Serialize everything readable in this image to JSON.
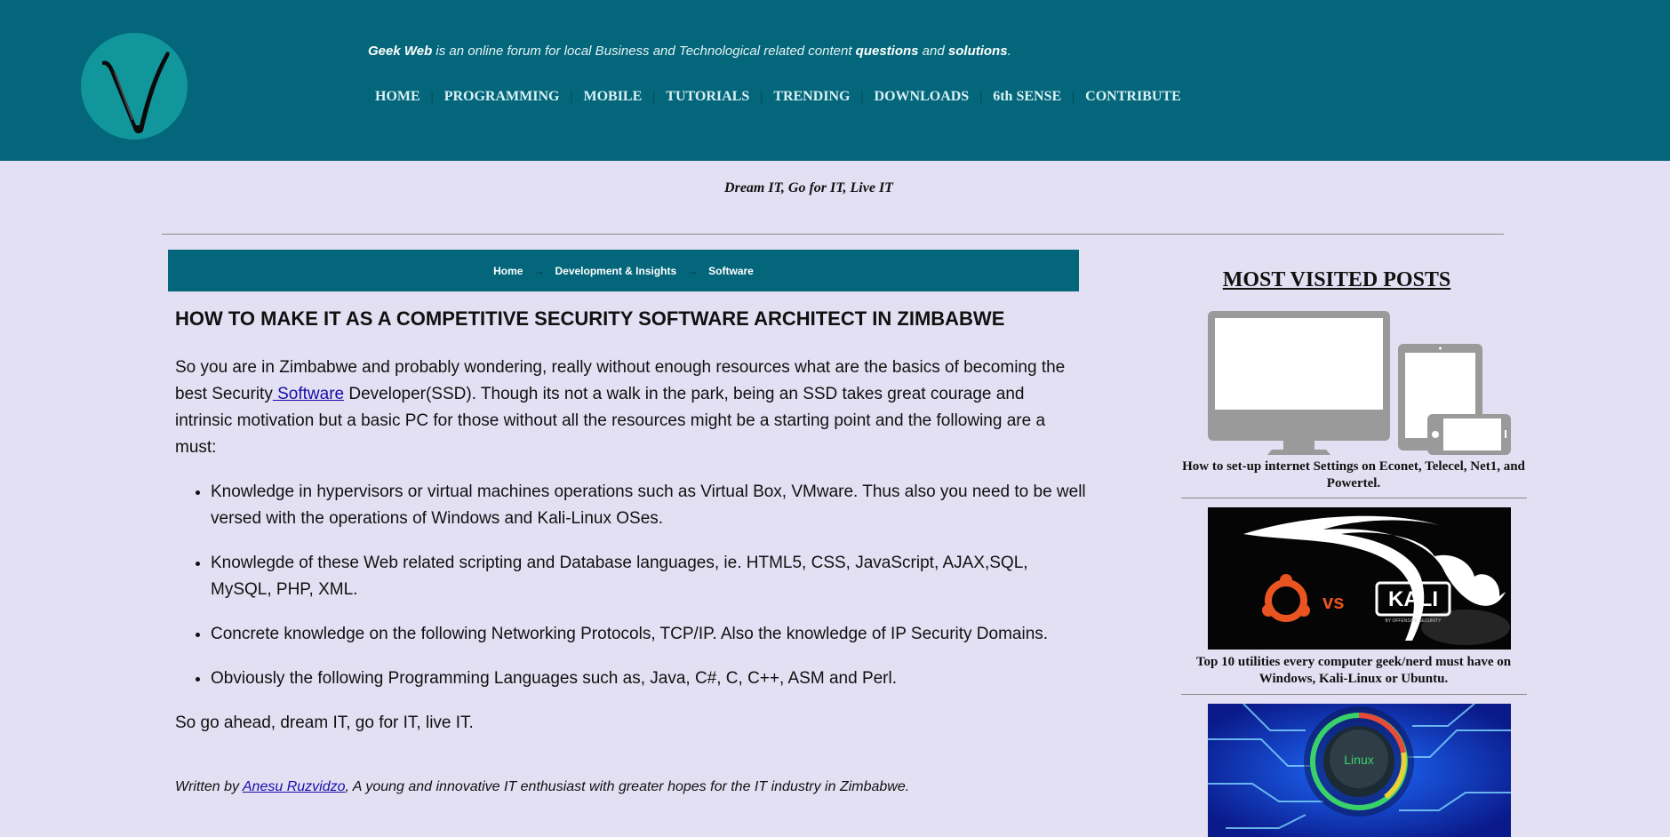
{
  "site": {
    "name": "Geek Web",
    "tagline_mid": " is an online forum for local Business and Technological related content ",
    "tagline_questions": "questions",
    "tagline_and": " and ",
    "tagline_solutions": "solutions",
    "tagline_end": ".",
    "motto": "Dream IT, Go for IT, Live IT"
  },
  "nav": {
    "items": [
      "HOME",
      "PROGRAMMING",
      "MOBILE",
      "TUTORIALS",
      "TRENDING",
      "DOWNLOADS",
      "6th SENSE",
      "CONTRIBUTE"
    ],
    "separator": "|"
  },
  "breadcrumb": {
    "items": [
      "Home",
      "Development & Insights",
      "Software"
    ],
    "arrow": "→"
  },
  "article": {
    "title": "HOW TO MAKE IT AS A COMPETITIVE SECURITY SOFTWARE ARCHITECT IN ZIMBABWE",
    "intro_before_link": "So you are in Zimbabwe and probably wondering, really without enough resources what are the basics of becoming the best Security",
    "intro_link": " Software",
    "intro_after_link": " Developer(SSD). Though its not a walk in the park, being an SSD takes great courage and intrinsic motivation but a basic PC for those without all the resources might be a starting point and the following are a must:",
    "bullets": [
      "Knowledge in hypervisors or virtual machines operations such as Virtual Box, VMware. Thus also you need to be well versed with the operations of Windows and Kali-Linux OSes.",
      "Knowlegde of these Web related scripting and Database languages, ie. HTML5, CSS, JavaScript, AJAX,SQL, MySQL, PHP, XML.",
      "Concrete knowledge on the following Networking Protocols, TCP/IP. Also the knowledge of IP Security Domains.",
      "Obviously the following Programming Languages such as, Java, C#, C, C++, ASM and Perl."
    ],
    "outro": "So go ahead, dream IT, go for IT, live IT.",
    "author_prefix": "Written by ",
    "author_name": "Anesu Ruzvidzo",
    "author_suffix": ", A young and innovative IT enthusiast with greater hopes for the IT industry in Zimbabwe."
  },
  "sidebar": {
    "title": "MOST VISITED POSTS",
    "posts": [
      {
        "caption": "How to set-up internet Settings on Econet, Telecel, Net1, and Powertel.",
        "image": "devices-illustration"
      },
      {
        "caption": "Top 10 utilities every computer geek/nerd must have on Windows, Kali-Linux or Ubuntu.",
        "image": "ubuntu-vs-kali-graphic",
        "image_text_vs": "vs",
        "image_text_kali": "KALI",
        "image_text_sub": "BY OFFENSIVE SECURITY"
      },
      {
        "caption": "",
        "image": "linux-circuit-graphic",
        "image_text": "Linux"
      }
    ]
  },
  "colors": {
    "header_bg": "#03667a",
    "page_bg": "#e2e0f2",
    "logo_bg": "#11969c",
    "link": "#1a0dab"
  }
}
